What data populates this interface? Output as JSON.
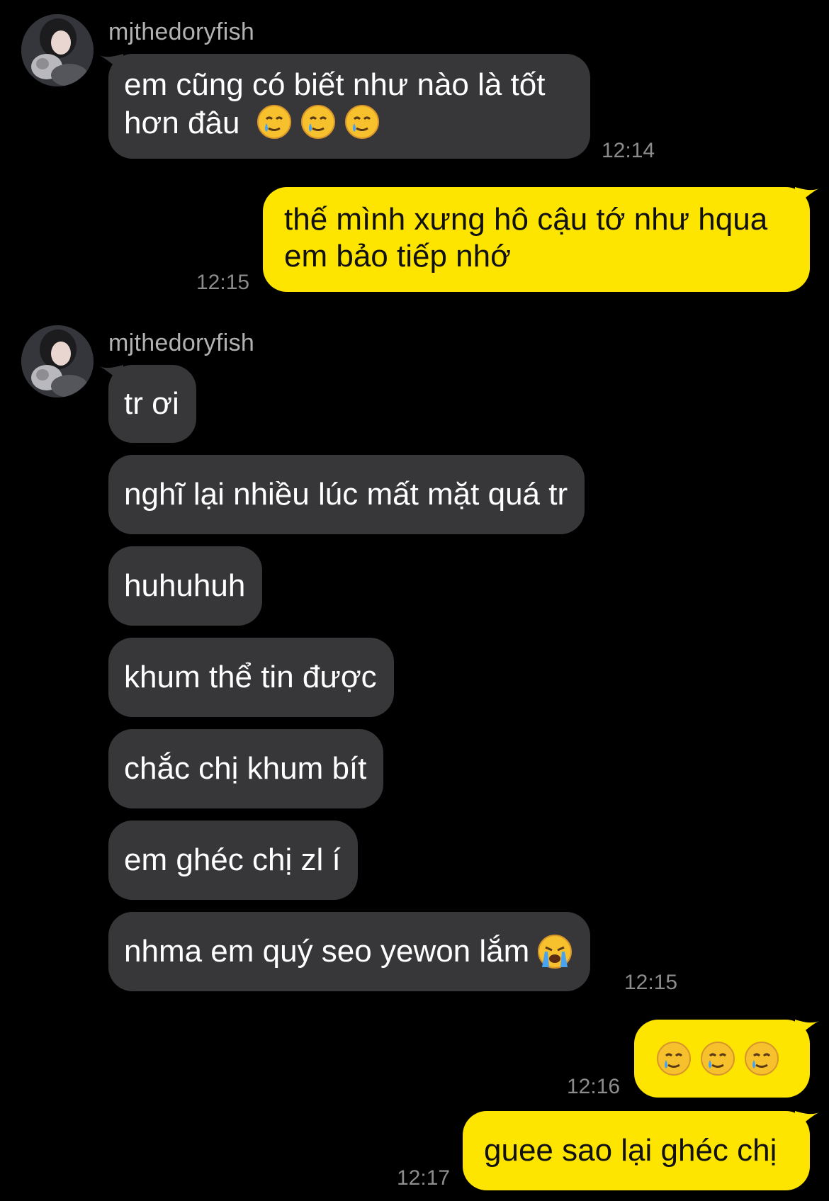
{
  "colors": {
    "background": "#000000",
    "incoming_bubble": "#37373a",
    "outgoing_bubble": "#fee500",
    "timestamp": "#8c8c8c",
    "sender_name": "#b2b2b2"
  },
  "icons": {
    "smile_tear": "smiling-face-with-tear-emoji",
    "loud_crying": "loudly-crying-face-emoji"
  },
  "messages": {
    "m1": {
      "sender": "mjthedoryfish",
      "line1": "em cũng có biết như nào là tốt",
      "line2": "hơn đâu",
      "time": "12:14"
    },
    "m2": {
      "line1": "thế mình xưng hô cậu tớ như hqua",
      "line2": "em bảo tiếp nhớ",
      "time": "12:15"
    },
    "group3": {
      "sender": "mjthedoryfish",
      "items": [
        "tr ơi",
        "nghĩ lại nhiều lúc mất mặt quá tr",
        "huhuhuh",
        "khum thể tin được",
        "chắc chị khum bít",
        "em ghéc chị zl í",
        "nhma em quý seo yewon lắm"
      ],
      "time": "12:15"
    },
    "m4": {
      "time": "12:16"
    },
    "m5": {
      "text": "guee sao lại ghéc chị",
      "time": "12:17"
    }
  }
}
